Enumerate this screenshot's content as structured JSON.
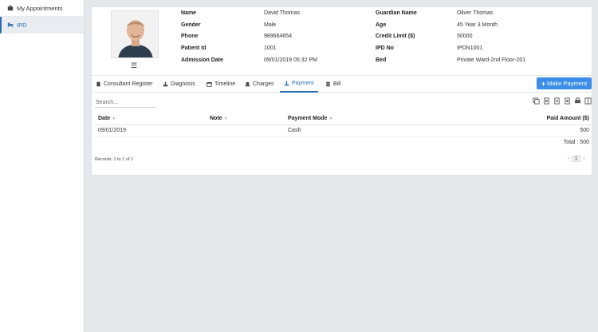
{
  "sidebar": {
    "items": [
      {
        "label": "My Appointments",
        "icon": "briefcase-icon"
      },
      {
        "label": "IPD",
        "icon": "bed-icon"
      }
    ]
  },
  "patient": {
    "name_label": "Name",
    "name": "David Thomas",
    "gender_label": "Gender",
    "gender": "Male",
    "phone_label": "Phone",
    "phone": "989664654",
    "patient_id_label": "Patient Id",
    "patient_id": "1001",
    "admission_label": "Admission Date",
    "admission": "09/01/2019 05:32 PM",
    "guardian_label": "Guardian Name",
    "guardian": "Oliver Thomas",
    "age_label": "Age",
    "age": "45 Year 3 Month",
    "credit_label": "Credit Limit ($)",
    "credit": "50000",
    "ipd_label": "IPD No",
    "ipd": "IPDN1001",
    "bed_label": "Bed",
    "bed": "Private Ward-2nd Floor-201"
  },
  "tabs": [
    {
      "label": "Consultant Register",
      "icon": "clipboard-icon"
    },
    {
      "label": "Diagnosis",
      "icon": "diagnosis-icon"
    },
    {
      "label": "Timeline",
      "icon": "calendar-icon"
    },
    {
      "label": "Charges",
      "icon": "charges-icon"
    },
    {
      "label": "Payment",
      "icon": "payment-icon"
    },
    {
      "label": "Bill",
      "icon": "bill-icon"
    }
  ],
  "active_tab": "Payment",
  "make_payment_label": "Make Payment",
  "search": {
    "placeholder": "Search..."
  },
  "table": {
    "headers": {
      "date": "Date",
      "note": "Note",
      "mode": "Payment Mode",
      "amount": "Paid Amount ($)"
    },
    "rows": [
      {
        "date": "09/01/2019",
        "note": "",
        "mode": "Cash",
        "amount": "500"
      }
    ],
    "total": "Total : 500"
  },
  "records": "Records: 1 to 1 of 1",
  "pager": {
    "prev": "‹",
    "page": "1",
    "next": "›"
  },
  "colors": {
    "accent": "#2b6cb0",
    "button": "#3b8ee8",
    "background": "#e5e7eb"
  }
}
